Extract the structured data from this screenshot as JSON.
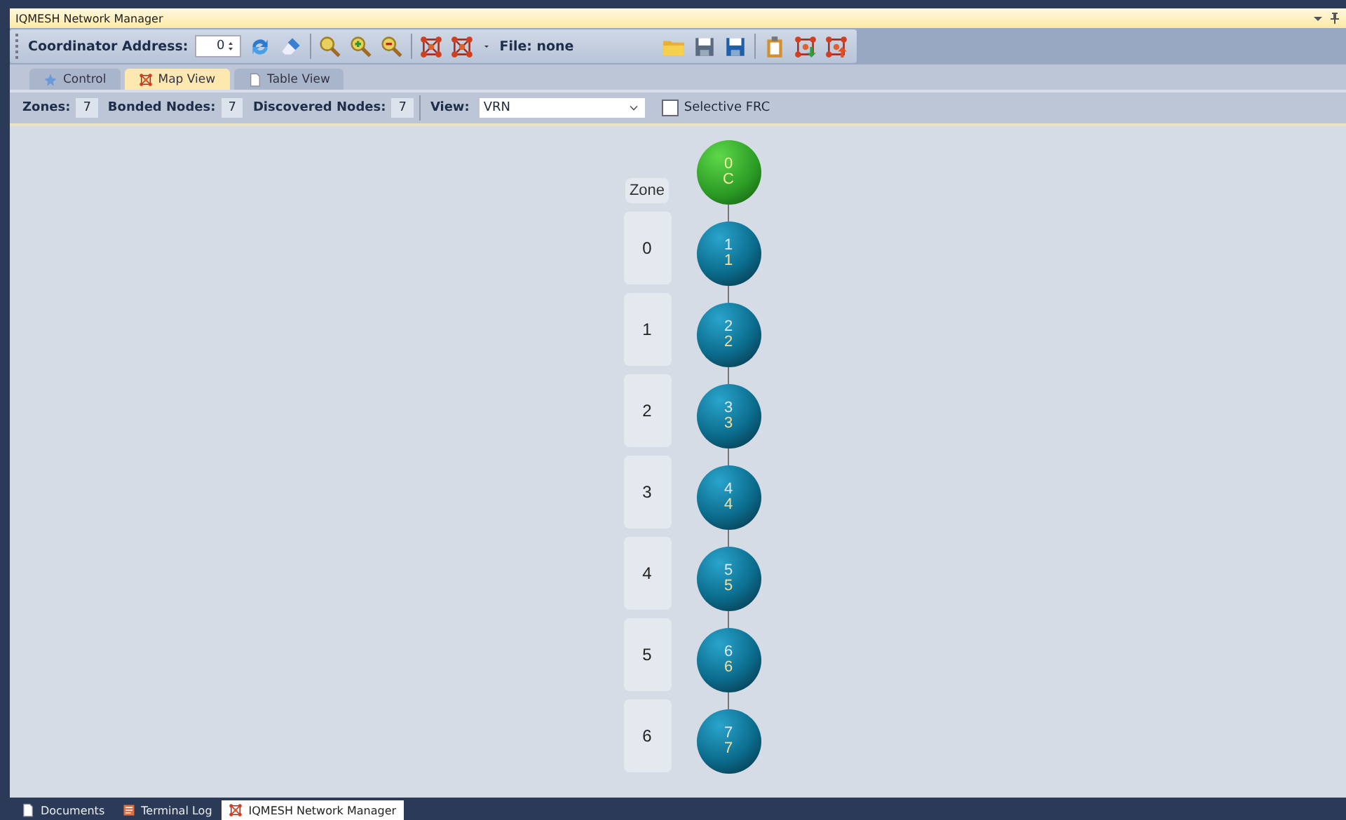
{
  "pane": {
    "title": "IQMESH Network Manager"
  },
  "toolbar": {
    "address_label": "Coordinator Address:",
    "address_value": "0",
    "file_label": "File: none"
  },
  "tabs": [
    {
      "label": "Control",
      "selected": false,
      "kind": "control"
    },
    {
      "label": "Map View",
      "selected": true,
      "kind": "map"
    },
    {
      "label": "Table View",
      "selected": false,
      "kind": "table"
    }
  ],
  "info_bar": {
    "zones_label": "Zones:",
    "zones": "7",
    "bonded_label": "Bonded Nodes:",
    "bonded": "7",
    "discovered_label": "Discovered Nodes:",
    "discovered": "7",
    "view_label": "View:",
    "view_value": "VRN",
    "selective_frc": {
      "label": "Selective FRC",
      "checked": false
    }
  },
  "map": {
    "zone_header": "Zone",
    "zones": [
      "0",
      "1",
      "2",
      "3",
      "4",
      "5",
      "6"
    ],
    "nodes": [
      {
        "kind": "coordinator",
        "address": "0",
        "zone": "C"
      },
      {
        "kind": "node",
        "address": "1",
        "zone": "1"
      },
      {
        "kind": "node",
        "address": "2",
        "zone": "2"
      },
      {
        "kind": "node",
        "address": "3",
        "zone": "3"
      },
      {
        "kind": "node",
        "address": "4",
        "zone": "4"
      },
      {
        "kind": "node",
        "address": "5",
        "zone": "5"
      },
      {
        "kind": "node",
        "address": "6",
        "zone": "6"
      },
      {
        "kind": "node",
        "address": "7",
        "zone": "7"
      }
    ]
  },
  "document_tabs": [
    {
      "label": "Documents",
      "selected": false,
      "kind": "doc"
    },
    {
      "label": "Terminal Log",
      "selected": false,
      "kind": "log"
    },
    {
      "label": "IQMESH Network Manager",
      "selected": true,
      "kind": "map"
    }
  ]
}
